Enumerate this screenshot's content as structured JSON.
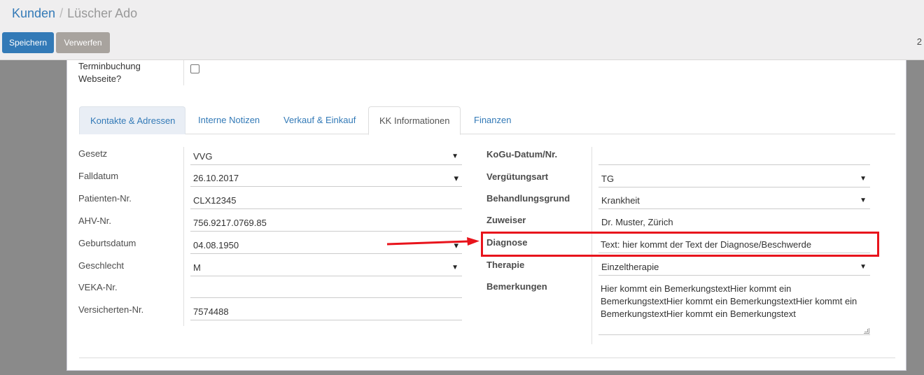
{
  "breadcrumb": {
    "parent": "Kunden",
    "separator": "/",
    "current": "Lüscher Ado"
  },
  "buttons": {
    "save": "Speichern",
    "discard": "Verwerfen"
  },
  "pager": "2",
  "top_field": {
    "label_line1": "Terminbuchung",
    "label_line2": "Webseite?",
    "checked": false
  },
  "tabs": [
    {
      "label": "Kontakte & Adressen"
    },
    {
      "label": "Interne Notizen"
    },
    {
      "label": "Verkauf & Einkauf"
    },
    {
      "label": "KK Informationen",
      "active": true
    },
    {
      "label": "Finanzen"
    }
  ],
  "left_fields": [
    {
      "label": "Gesetz",
      "value": "VVG",
      "type": "select"
    },
    {
      "label": "Falldatum",
      "value": "26.10.2017",
      "type": "date"
    },
    {
      "label": "Patienten-Nr.",
      "value": "CLX12345",
      "type": "text"
    },
    {
      "label": "AHV-Nr.",
      "value": "756.9217.0769.85",
      "type": "text"
    },
    {
      "label": "Geburtsdatum",
      "value": "04.08.1950",
      "type": "date"
    },
    {
      "label": "Geschlecht",
      "value": "M",
      "type": "select"
    },
    {
      "label": "VEKA-Nr.",
      "value": "",
      "type": "text"
    },
    {
      "label": "Versicherten-Nr.",
      "value": "7574488",
      "type": "text"
    }
  ],
  "right_fields": [
    {
      "label": "KoGu-Datum/Nr.",
      "value": "",
      "type": "text"
    },
    {
      "label": "Vergütungsart",
      "value": "TG",
      "type": "select"
    },
    {
      "label": "Behandlungsgrund",
      "value": "Krankheit",
      "type": "select"
    },
    {
      "label": "Zuweiser",
      "value": "Dr. Muster, Zürich",
      "type": "readonly"
    },
    {
      "label": "Diagnose",
      "value": "Text: hier kommt der Text der Diagnose/Beschwerde",
      "type": "text"
    },
    {
      "label": "Therapie",
      "value": "Einzeltherapie",
      "type": "select"
    },
    {
      "label": "Bemerkungen",
      "value": "Hier kommt ein BemerkungstextHier kommt ein BemerkungstextHier kommt ein BemerkungstextHier kommt ein BemerkungstextHier kommt ein Bemerkungstext",
      "type": "textarea"
    }
  ],
  "icons": {
    "dropdown": "▼",
    "date_dropdown": "▾"
  },
  "annotation": {
    "color": "#e8141c"
  }
}
